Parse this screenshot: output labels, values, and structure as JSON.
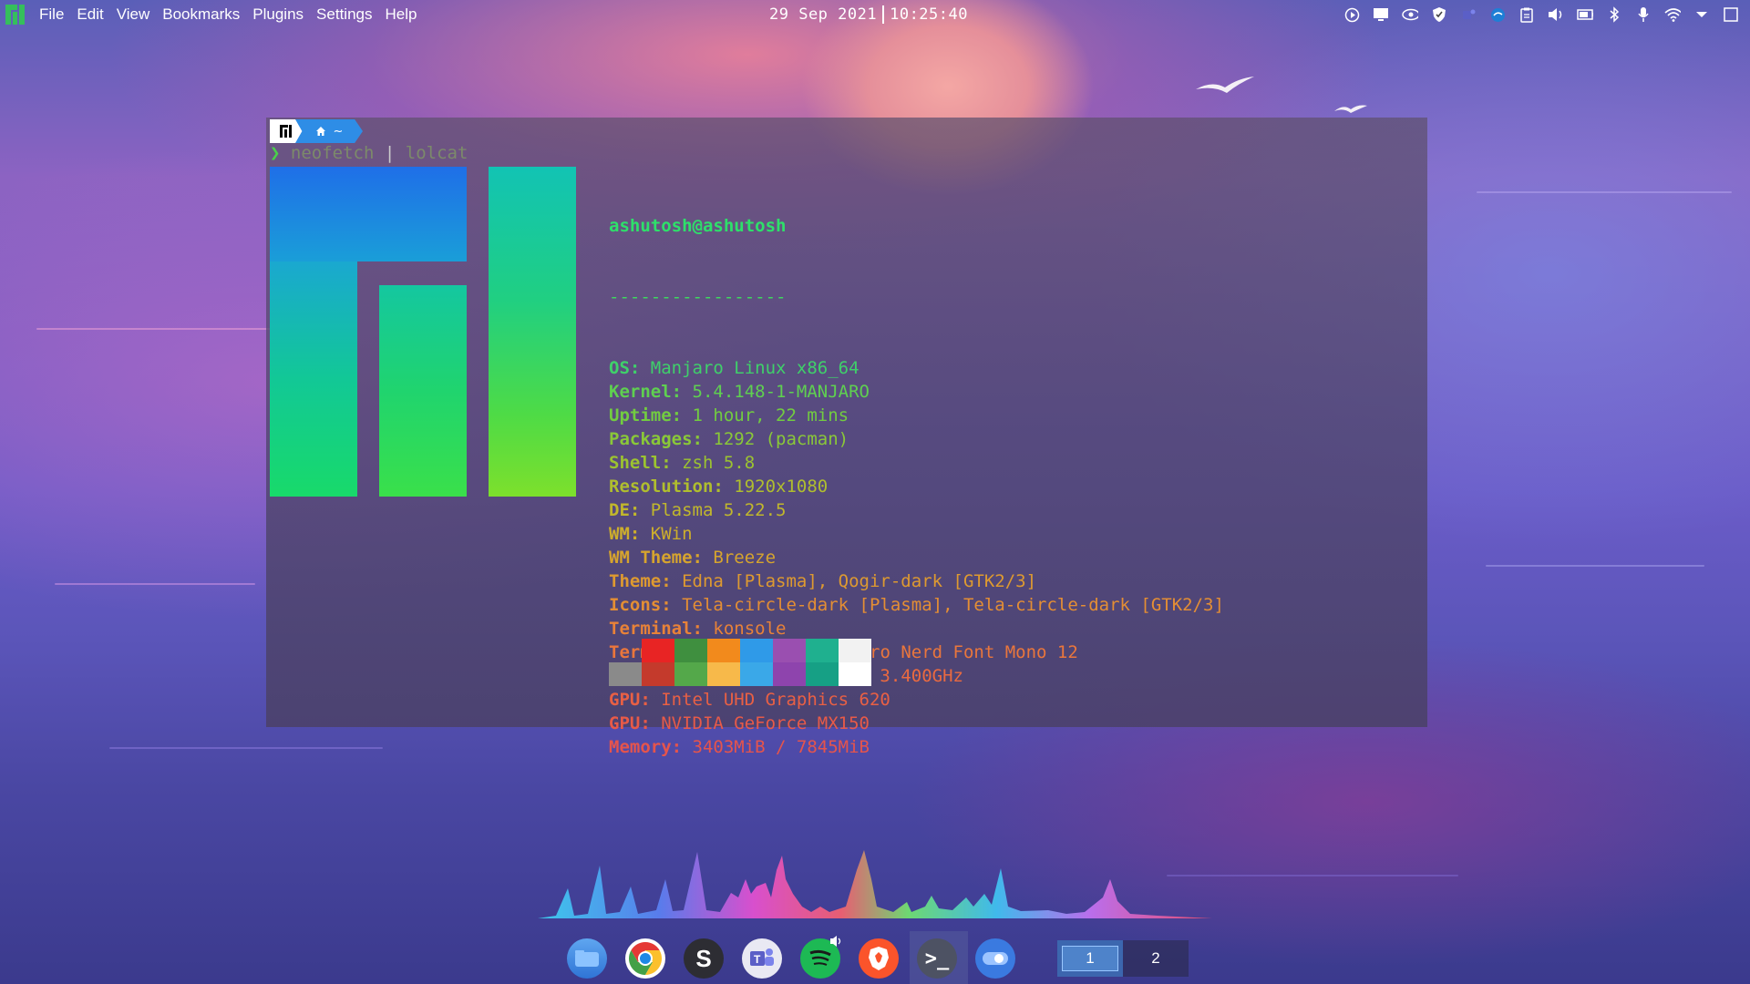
{
  "menubar": {
    "items": [
      "File",
      "Edit",
      "View",
      "Bookmarks",
      "Plugins",
      "Settings",
      "Help"
    ]
  },
  "clock": {
    "date": "29 Sep 2021",
    "time": "10:25:40"
  },
  "tray": {
    "icons": [
      "media-player-icon",
      "display-icon",
      "eye-icon",
      "shield-icon",
      "teams-tray-icon",
      "browser-tray-icon",
      "clipboard-icon",
      "volume-icon",
      "battery-icon",
      "bluetooth-icon",
      "microphone-icon",
      "wifi-icon",
      "expand-arrow-icon",
      "show-desktop-icon"
    ]
  },
  "terminal": {
    "prompt_dir": "~",
    "command": "neofetch",
    "pipe": "|",
    "command2": "lolcat"
  },
  "neofetch": {
    "user_host": "ashutosh@ashutosh",
    "separator": "-----------------",
    "lines": [
      {
        "label": "OS",
        "value": "Manjaro Linux x86_64"
      },
      {
        "label": "Kernel",
        "value": "5.4.148-1-MANJARO"
      },
      {
        "label": "Uptime",
        "value": "1 hour, 22 mins"
      },
      {
        "label": "Packages",
        "value": "1292 (pacman)"
      },
      {
        "label": "Shell",
        "value": "zsh 5.8"
      },
      {
        "label": "Resolution",
        "value": "1920x1080"
      },
      {
        "label": "DE",
        "value": "Plasma 5.22.5"
      },
      {
        "label": "WM",
        "value": "KWin"
      },
      {
        "label": "WM Theme",
        "value": "Breeze"
      },
      {
        "label": "Theme",
        "value": "Edna [Plasma], Qogir-dark [GTK2/3]"
      },
      {
        "label": "Icons",
        "value": "Tela-circle-dark [Plasma], Tela-circle-dark [GTK2/3]"
      },
      {
        "label": "Terminal",
        "value": "konsole"
      },
      {
        "label": "Terminal Font",
        "value": "SauceCodePro Nerd Font Mono 12"
      },
      {
        "label": "CPU",
        "value": "Intel i5-8250U (8) @ 3.400GHz"
      },
      {
        "label": "GPU",
        "value": "Intel UHD Graphics 620"
      },
      {
        "label": "GPU",
        "value": "NVIDIA GeForce MX150"
      },
      {
        "label": "Memory",
        "value": "3403MiB / 7845MiB"
      }
    ],
    "line_colors": [
      "#3fd06a",
      "#5fd050",
      "#72cc40",
      "#8ac838",
      "#9cc330",
      "#b0be2e",
      "#c1b72c",
      "#cdae2c",
      "#d6a42e",
      "#de9a30",
      "#e48e34",
      "#e88238",
      "#ea763c",
      "#ea6a40",
      "#e96044",
      "#e85a48",
      "#e5544c"
    ],
    "palette_top": [
      "#2b2b3a",
      "#e82424",
      "#3f8f3f",
      "#f28a1c",
      "#2f9ae8",
      "#9a4fb0",
      "#1fb08f",
      "#f2f2f2"
    ],
    "palette_bottom": [
      "#8a8a8a",
      "#c43a2c",
      "#54a84a",
      "#f7b94a",
      "#3aa8e8",
      "#8e44ad",
      "#16a085",
      "#ffffff"
    ]
  },
  "dock": {
    "apps": [
      "Dolphin",
      "Chrome",
      "Simplenote",
      "Teams",
      "Spotify",
      "Brave",
      "Konsole",
      "Toggle"
    ],
    "desktops": [
      "1",
      "2"
    ]
  }
}
